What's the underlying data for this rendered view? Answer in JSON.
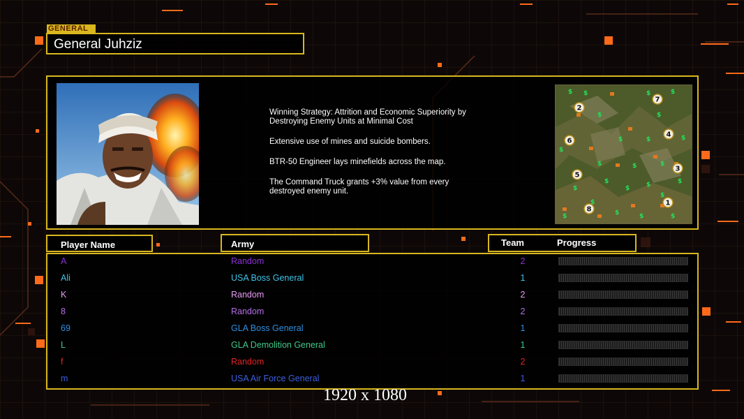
{
  "general_tag": "GENERAL",
  "general_name": "General Juhziz",
  "strategy": [
    "Winning Strategy: Attrition and Economic Superiority by\n Destroying Enemy Units at Minimal Cost",
    "Extensive use of mines and suicide bombers.",
    "BTR-50 Engineer lays minefields across the map.",
    "The Command Truck grants +3% value from every\n destroyed enemy unit."
  ],
  "minimap": {
    "start_positions": [
      "2",
      "7",
      "6",
      "4",
      "3",
      "5",
      "1",
      "8"
    ]
  },
  "headers": {
    "player_name": "Player Name",
    "army": "Army",
    "team": "Team",
    "progress": "Progress"
  },
  "players": [
    {
      "name": "A",
      "army": "Random",
      "team": "2",
      "color": "#8b2fd6",
      "progress": 0
    },
    {
      "name": "Ali",
      "army": "USA Boss General",
      "team": "1",
      "color": "#3fc3e8",
      "progress": 0
    },
    {
      "name": "K",
      "army": "Random",
      "team": "2",
      "color": "#e79bf5",
      "progress": 0
    },
    {
      "name": "8",
      "army": "Random",
      "team": "2",
      "color": "#b56fe8",
      "progress": 0
    },
    {
      "name": "69",
      "army": "GLA Boss General",
      "team": "1",
      "color": "#2f8fe0",
      "progress": 0
    },
    {
      "name": "L",
      "army": "GLA Demolition General",
      "team": "1",
      "color": "#3fc88a",
      "progress": 0
    },
    {
      "name": "f",
      "army": "Random",
      "team": "2",
      "color": "#e02424",
      "progress": 0
    },
    {
      "name": "m",
      "army": "USA Air Force General",
      "team": "1",
      "color": "#3a5fe0",
      "progress": 0
    }
  ],
  "resolution_label": "1920 x 1080",
  "colors": {
    "frame": "#d9b71e",
    "accent_orange": "#ff6a1a"
  }
}
